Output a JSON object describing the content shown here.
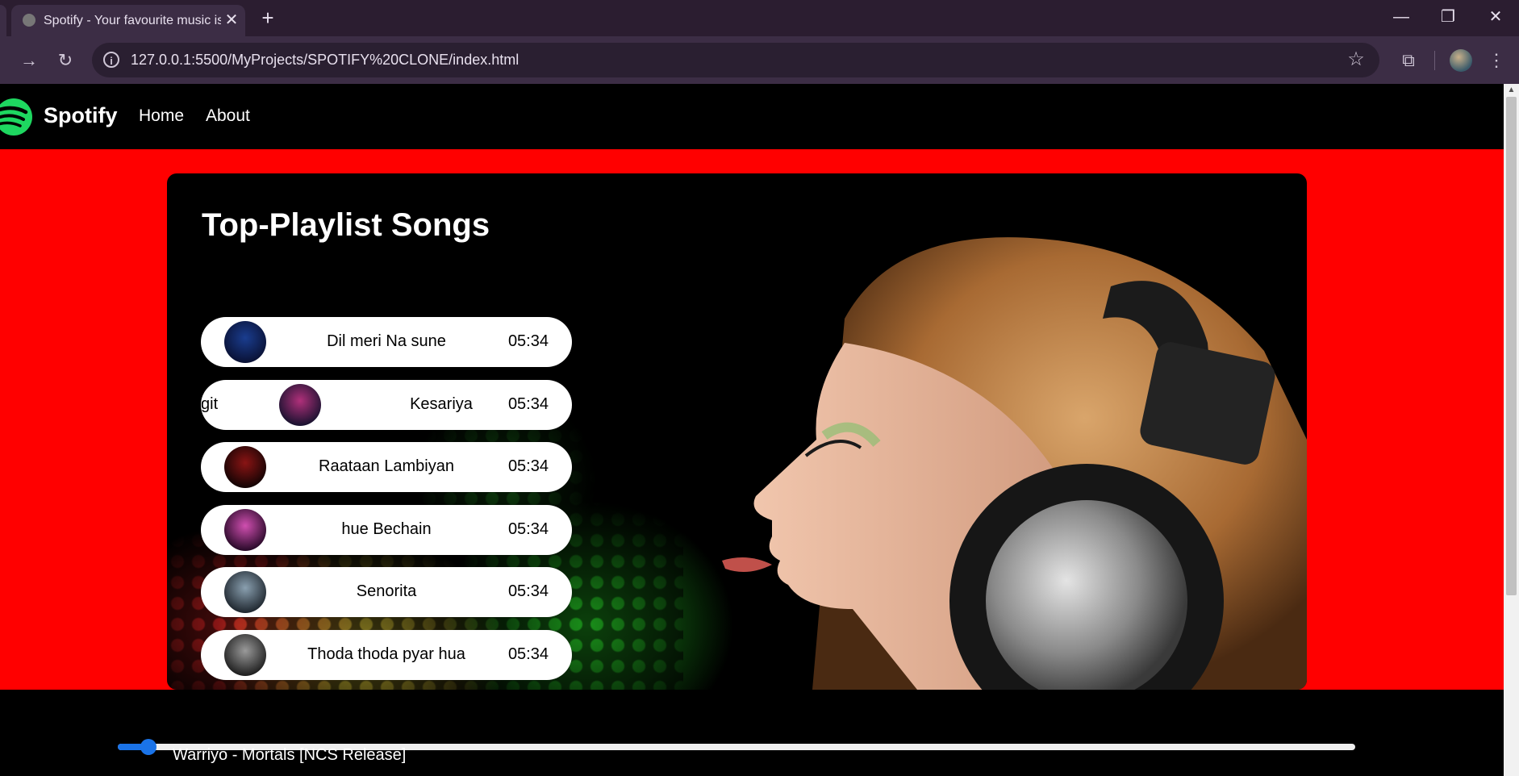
{
  "browser": {
    "tab_title": "Spotify - Your favourite music is here",
    "close_glyph": "✕",
    "new_tab_glyph": "+",
    "url": "127.0.0.1:5500/MyProjects/SPOTIFY%20CLONE/index.html",
    "window_buttons": {
      "minimize": "—",
      "restore": "❐",
      "close": "✕"
    }
  },
  "nav": {
    "brand": "Spotify",
    "links": [
      "Home",
      "About"
    ]
  },
  "main": {
    "title": "Top-Playlist Songs",
    "songs": [
      {
        "prefix": "",
        "name": "Dil meri Na sune",
        "time": "05:34",
        "cover_colors": [
          "#1a3d8f",
          "#0a1236"
        ]
      },
      {
        "prefix": "git",
        "name": "Kesariya",
        "time": "05:34",
        "cover_colors": [
          "#b0307a",
          "#1a1230"
        ]
      },
      {
        "prefix": "",
        "name": "Raataan Lambiyan",
        "time": "05:34",
        "cover_colors": [
          "#8a1414",
          "#140404"
        ]
      },
      {
        "prefix": "",
        "name": "hue Bechain",
        "time": "05:34",
        "cover_colors": [
          "#d04fb0",
          "#2a0a2a"
        ]
      },
      {
        "prefix": "",
        "name": "Senorita",
        "time": "05:34",
        "cover_colors": [
          "#8aa0b0",
          "#202830"
        ]
      },
      {
        "prefix": "",
        "name": "Thoda thoda pyar hua",
        "time": "05:34",
        "cover_colors": [
          "#9a9a9a",
          "#202020"
        ]
      }
    ]
  },
  "player": {
    "now_playing": "Warriyo - Mortals [NCS Release]",
    "progress": 0.025,
    "accent": "#1a73e8"
  },
  "colors": {
    "page_bg": "#ff0000",
    "spotify_green": "#1ed760"
  }
}
